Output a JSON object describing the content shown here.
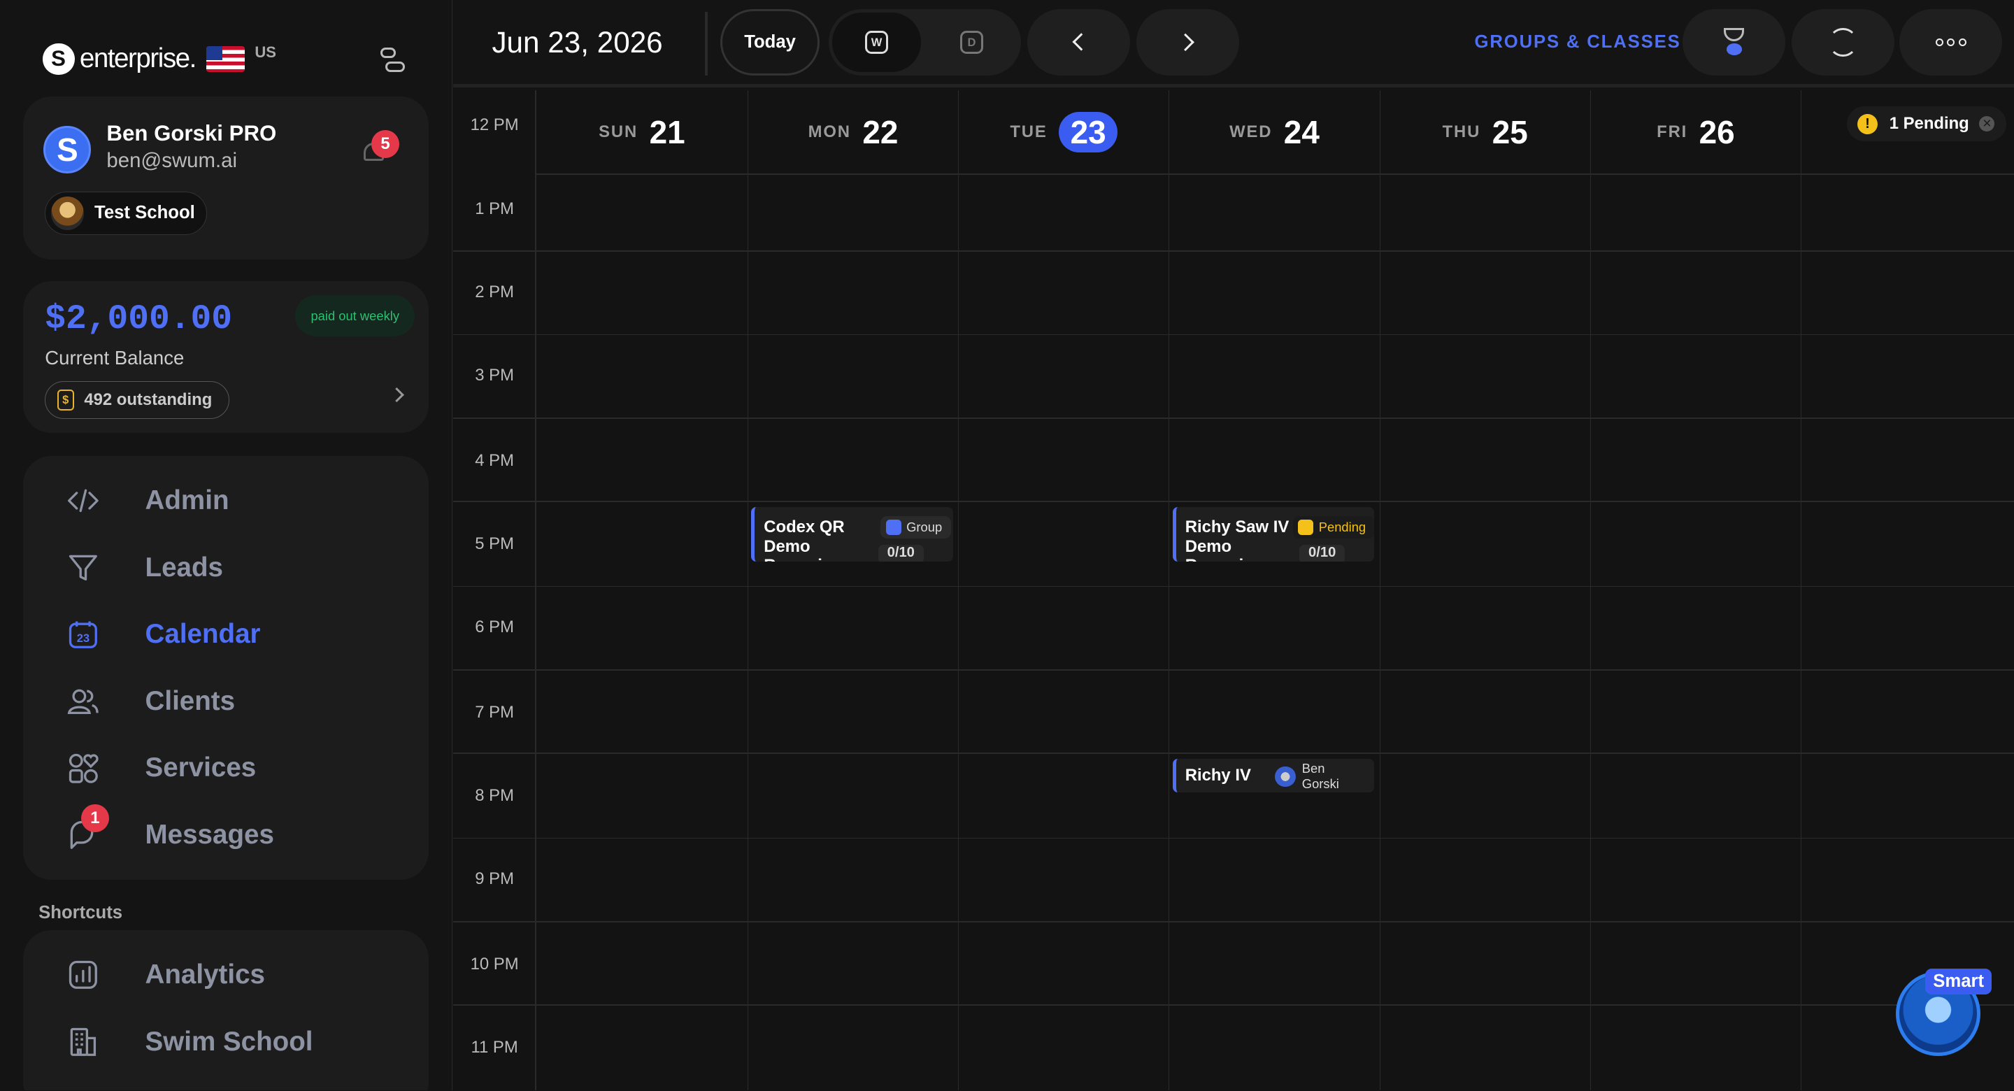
{
  "brand": {
    "name": "enterprise.",
    "logo_letter": "S",
    "region": "US"
  },
  "profile": {
    "avatar_letter": "S",
    "name": "Ben Gorski PRO",
    "email": "ben@swum.ai",
    "notification_count": "5",
    "school": "Test School"
  },
  "balance": {
    "amount": "$2,000.00",
    "payout": "paid out weekly",
    "label": "Current Balance",
    "outstanding": "492 outstanding",
    "coin_symbol": "$"
  },
  "nav": {
    "items": [
      {
        "label": "Admin",
        "icon": "code-icon"
      },
      {
        "label": "Leads",
        "icon": "funnel-icon"
      },
      {
        "label": "Calendar",
        "icon": "calendar-icon",
        "active": true,
        "icon_text": "23"
      },
      {
        "label": "Clients",
        "icon": "users-icon"
      },
      {
        "label": "Services",
        "icon": "services-icon"
      },
      {
        "label": "Messages",
        "icon": "chat-icon",
        "badge": "1"
      }
    ]
  },
  "shortcuts": {
    "title": "Shortcuts",
    "items": [
      {
        "label": "Analytics",
        "icon": "analytics-icon"
      },
      {
        "label": "Swim School",
        "icon": "building-icon"
      }
    ]
  },
  "topbar": {
    "date": "Jun 23, 2026",
    "today": "Today",
    "view_week": "W",
    "view_day": "D",
    "groups_link": "GROUPS & CLASSES"
  },
  "calendar": {
    "hours": [
      "12 PM",
      "1 PM",
      "2 PM",
      "3 PM",
      "4 PM",
      "5 PM",
      "6 PM",
      "7 PM",
      "8 PM",
      "9 PM",
      "10 PM",
      "11 PM"
    ],
    "days": [
      {
        "dow": "SUN",
        "num": "21"
      },
      {
        "dow": "MON",
        "num": "22"
      },
      {
        "dow": "TUE",
        "num": "23",
        "today": true
      },
      {
        "dow": "WED",
        "num": "24"
      },
      {
        "dow": "THU",
        "num": "25"
      },
      {
        "dow": "FRI",
        "num": "26"
      },
      {
        "dow": "",
        "num": ""
      }
    ],
    "events": [
      {
        "title": "Codex QR Demo Recurring",
        "tag": "Group",
        "count": "0/10",
        "day": "MON",
        "start": "5 PM"
      },
      {
        "title": "Richy Saw IV Demo Recurring",
        "tag": "Pending",
        "count": "0/10",
        "day": "WED",
        "start": "5 PM"
      },
      {
        "title": "Richy IV",
        "tag": "Ben Gorski",
        "day": "WED",
        "start": "8 PM"
      }
    ],
    "pending": {
      "label": "1 Pending",
      "warn_symbol": "!",
      "close_symbol": "✕"
    }
  },
  "assistant": {
    "label": "Smart"
  },
  "colors": {
    "accent": "#4f6ff5",
    "today_highlight": "#3b5cf0",
    "badge_red": "#e5394a",
    "pending_yellow": "#f3c11a",
    "payout_green": "#2fbf71"
  }
}
